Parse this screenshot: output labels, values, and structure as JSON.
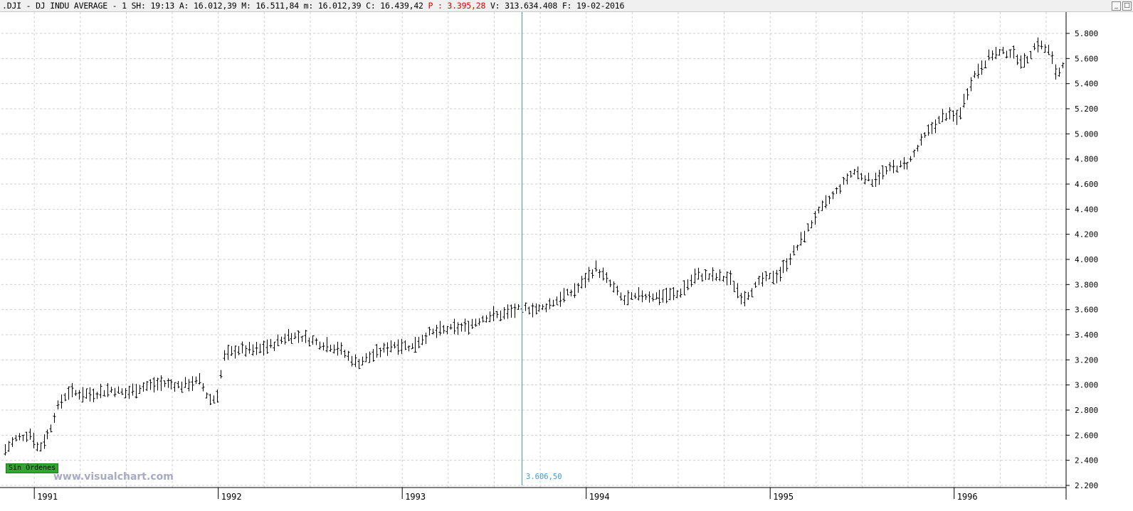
{
  "header": {
    "symbol": ".DJI",
    "name": "- DJ INDU AVERAGE -",
    "timeframe": "1 S",
    "H": "H: 19:13",
    "A": "A: 16.012,39",
    "M": "M: 16.511,84",
    "m": "m: 16.012,39",
    "C": "C: 16.439,42",
    "P": "P : 3.395,28",
    "V": "V: 313.634.408",
    "F": "F: 19-02-2016",
    "p_color": "#e00000"
  },
  "window_controls": {
    "minimize": "_",
    "maximize": "□"
  },
  "badge_text": "Sin Órdenes",
  "watermark": "www.visualchart.com",
  "cursor": {
    "value_label": "3.606,50",
    "color": "#3b9ad8",
    "date": 1993.65
  },
  "chart_data": {
    "type": "ohlc-bar",
    "x_labels": [
      "1991",
      "1992",
      "1993",
      "1994",
      "1995",
      "1996"
    ],
    "x_range": [
      1990.82,
      1996.6
    ],
    "y_ticks": [
      "2.200",
      "2.400",
      "2.600",
      "2.800",
      "3.000",
      "3.200",
      "3.400",
      "3.600",
      "3.800",
      "4.000",
      "4.200",
      "4.400",
      "4.600",
      "4.800",
      "5.000",
      "5.200",
      "5.400",
      "5.600",
      "5.800"
    ],
    "y_range": [
      2200,
      5900
    ],
    "grid": "dashed",
    "bar_color": "#000000",
    "price_path": [
      [
        1990.82,
        2450
      ],
      [
        1990.9,
        2570
      ],
      [
        1990.98,
        2610
      ],
      [
        1991.02,
        2480
      ],
      [
        1991.08,
        2620
      ],
      [
        1991.12,
        2800
      ],
      [
        1991.18,
        2940
      ],
      [
        1991.3,
        2920
      ],
      [
        1991.42,
        2960
      ],
      [
        1991.5,
        2930
      ],
      [
        1991.58,
        2980
      ],
      [
        1991.7,
        3010
      ],
      [
        1991.8,
        2990
      ],
      [
        1991.9,
        3030
      ],
      [
        1991.95,
        2880
      ],
      [
        1991.99,
        2890
      ],
      [
        1992.03,
        3220
      ],
      [
        1992.1,
        3280
      ],
      [
        1992.2,
        3270
      ],
      [
        1992.3,
        3320
      ],
      [
        1992.38,
        3390
      ],
      [
        1992.45,
        3380
      ],
      [
        1992.55,
        3330
      ],
      [
        1992.65,
        3290
      ],
      [
        1992.75,
        3170
      ],
      [
        1992.85,
        3240
      ],
      [
        1992.95,
        3320
      ],
      [
        1993.05,
        3300
      ],
      [
        1993.15,
        3410
      ],
      [
        1993.25,
        3440
      ],
      [
        1993.35,
        3460
      ],
      [
        1993.45,
        3540
      ],
      [
        1993.55,
        3560
      ],
      [
        1993.65,
        3610
      ],
      [
        1993.75,
        3600
      ],
      [
        1993.85,
        3680
      ],
      [
        1993.95,
        3760
      ],
      [
        1994.05,
        3930
      ],
      [
        1994.12,
        3820
      ],
      [
        1994.2,
        3670
      ],
      [
        1994.3,
        3710
      ],
      [
        1994.4,
        3700
      ],
      [
        1994.5,
        3720
      ],
      [
        1994.6,
        3870
      ],
      [
        1994.7,
        3860
      ],
      [
        1994.78,
        3840
      ],
      [
        1994.85,
        3680
      ],
      [
        1994.95,
        3830
      ],
      [
        1995.05,
        3880
      ],
      [
        1995.15,
        4100
      ],
      [
        1995.25,
        4350
      ],
      [
        1995.35,
        4520
      ],
      [
        1995.45,
        4700
      ],
      [
        1995.55,
        4620
      ],
      [
        1995.65,
        4720
      ],
      [
        1995.75,
        4760
      ],
      [
        1995.85,
        5000
      ],
      [
        1995.95,
        5150
      ],
      [
        1996.02,
        5120
      ],
      [
        1996.1,
        5450
      ],
      [
        1996.2,
        5630
      ],
      [
        1996.3,
        5650
      ],
      [
        1996.38,
        5560
      ],
      [
        1996.45,
        5720
      ],
      [
        1996.52,
        5650
      ],
      [
        1996.56,
        5450
      ],
      [
        1996.6,
        5600
      ]
    ]
  }
}
